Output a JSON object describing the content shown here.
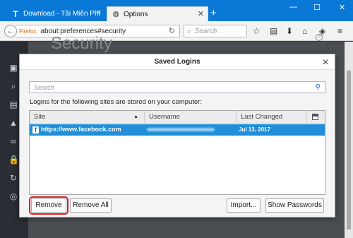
{
  "tabs": [
    {
      "icon": "T",
      "label": "Download - Tải Miễn Phí VN",
      "active": false
    },
    {
      "icon": "⚙",
      "label": "Options",
      "active": true
    }
  ],
  "navbar": {
    "brand": "Firefox",
    "url": "about:preferences#security",
    "search_placeholder": "Search"
  },
  "page": {
    "heading": "Security"
  },
  "dialog": {
    "title": "Saved Logins",
    "search_placeholder": "Search",
    "info": "Logins for the following sites are stored on your computer:",
    "columns": [
      "Site",
      "Username",
      "Last Changed"
    ],
    "rows": [
      {
        "site": "https://www.facebook.com",
        "username": "",
        "last_changed": "Jul 13, 2017",
        "selected": true
      }
    ],
    "buttons": {
      "remove": "Remove",
      "remove_all": "Remove All",
      "import": "Import...",
      "show_passwords": "Show Passwords"
    }
  },
  "colors": {
    "tabstrip": "#0a78d6",
    "selection": "#1e8fd8",
    "highlight": "#d51f2a"
  }
}
